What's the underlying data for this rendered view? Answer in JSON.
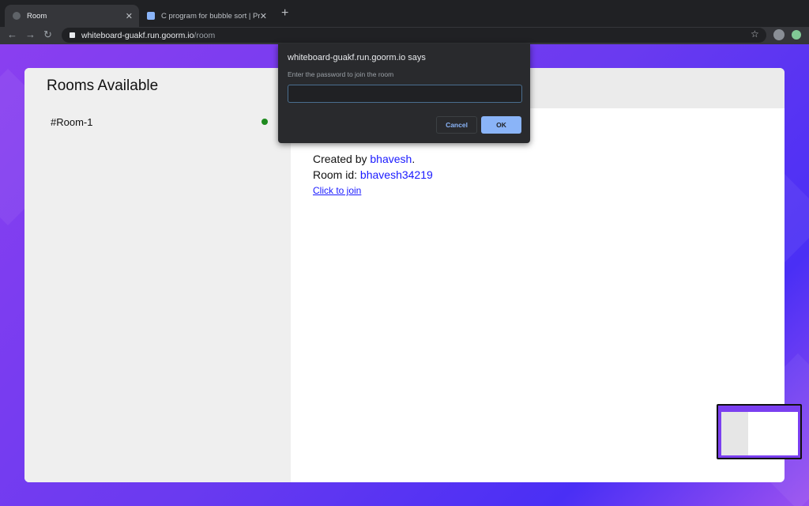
{
  "browser": {
    "tabs": [
      {
        "label": "Room",
        "active": true
      },
      {
        "label": "C program for bubble sort | Pr"
      }
    ],
    "url_host": "whiteboard-guakf.run.goorm.io",
    "url_path": "/room"
  },
  "sidebar": {
    "title": "Rooms Available",
    "rooms": [
      {
        "label": "#Room-1",
        "status_color": "#1e8a1e"
      }
    ]
  },
  "room": {
    "created_by_label": "Created by ",
    "creator": "bhavesh",
    "period": ".",
    "room_id_label": "Room id: ",
    "room_id": "bhavesh34219",
    "join_link": "Click to join"
  },
  "dialog": {
    "title": "whiteboard-guakf.run.goorm.io says",
    "message": "Enter the password to join the room",
    "input_value": "",
    "cancel": "Cancel",
    "ok": "OK"
  }
}
